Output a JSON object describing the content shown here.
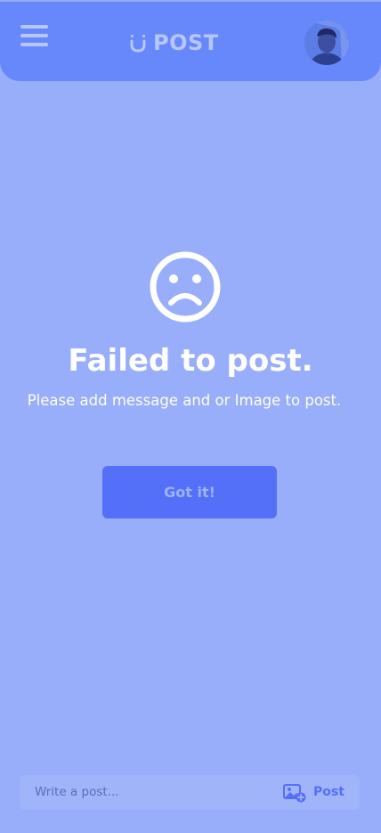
{
  "header": {
    "logo_text": "POST",
    "menu_icon": "hamburger-menu-icon",
    "logo_icon": "smile-mark-icon",
    "avatar_icon": "user-avatar"
  },
  "dialog": {
    "icon": "sad-face-icon",
    "title": "Failed to post.",
    "message": "Please add message and or Image to post.",
    "confirm_label": "Got it!"
  },
  "composer": {
    "placeholder": "Write a post...",
    "image_icon": "add-image-icon",
    "post_label": "Post"
  },
  "colors": {
    "overlay_background": "#98aefa",
    "header_background": "#6688fb",
    "accent": "#5470f8",
    "text_on_overlay": "#ffffff"
  }
}
